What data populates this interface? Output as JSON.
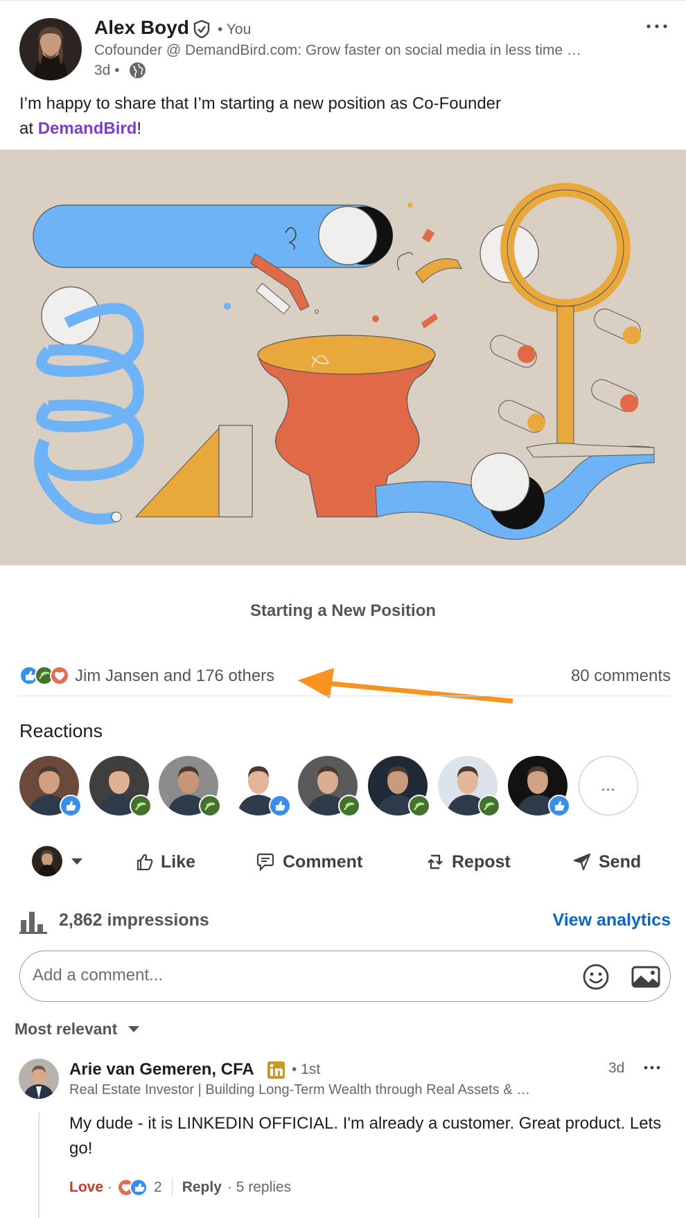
{
  "post": {
    "author_name": "Alex Boyd",
    "you_label": "• You",
    "headline": "Cofounder @ DemandBird.com: Grow faster on social media in less time …",
    "time": "3d •",
    "text_line1": "I’m happy to share that I’m starting a new position as Co-Founder",
    "text_at": "at ",
    "mention": "DemandBird",
    "text_end": "!",
    "illustration_caption": "Starting a New Position"
  },
  "social": {
    "reactors_text": "Jim Jansen and 176 others",
    "comments_text": "80 comments",
    "reactions_title": "Reactions",
    "more_reactors": "...",
    "reactor_badges": [
      "like",
      "celebrate",
      "celebrate",
      "like",
      "celebrate",
      "celebrate",
      "celebrate",
      "like"
    ]
  },
  "actions": {
    "like": "Like",
    "comment": "Comment",
    "repost": "Repost",
    "send": "Send"
  },
  "impressions": {
    "text": "2,862 impressions",
    "analytics_link": "View analytics"
  },
  "comment_input": {
    "placeholder": "Add a comment..."
  },
  "sort": {
    "label": "Most relevant"
  },
  "comment": {
    "author": "Arie van Gemeren, CFA",
    "degree": "• 1st",
    "headline": "Real Estate Investor | Building Long-Term Wealth through Real Assets & …",
    "time": "3d",
    "text": "My dude - it is LINKEDIN OFFICIAL. I'm already a customer. Great product. Lets go!",
    "reaction_label": "Love",
    "dot": "·",
    "reaction_count": "2",
    "reply_label": "Reply",
    "replies": "· 5 replies"
  },
  "colors": {
    "accent_link": "#0a66c2",
    "mention": "#7a3fcf",
    "love": "#c73a22",
    "illustration_bg": "#d9cfc3",
    "annotation_arrow": "#f7931e"
  },
  "icons": [
    "verified-icon",
    "globe-icon",
    "more-icon",
    "like-icon",
    "comment-icon",
    "repost-icon",
    "send-icon",
    "impressions-icon",
    "emoji-icon",
    "image-icon",
    "caret-down-icon",
    "linkedin-icon"
  ]
}
